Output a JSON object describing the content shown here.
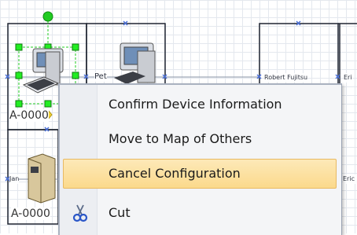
{
  "canvas": {
    "rooms": [
      {
        "label": "Pet"
      },
      {
        "label": "Robert Fujitsu"
      },
      {
        "label": "Eri"
      },
      {
        "label": "Jan"
      },
      {
        "label": "Eric"
      }
    ],
    "devices": [
      {
        "label": "A-0000"
      },
      {
        "label": "A-0000"
      }
    ]
  },
  "context_menu": {
    "items": [
      {
        "label": "Confirm Device Information",
        "icon": ""
      },
      {
        "label": "Move to Map of Others",
        "icon": ""
      },
      {
        "label": "Cancel Configuration",
        "icon": "",
        "selected": true
      },
      {
        "label": "Cut",
        "icon": "scissors-icon"
      }
    ]
  },
  "colors": {
    "grid": "#e4e8ee",
    "frame": "#1f2430",
    "handle": "#22cc22",
    "connector_x": "#4a6fd8",
    "menu_highlight": "#fbd98c"
  }
}
